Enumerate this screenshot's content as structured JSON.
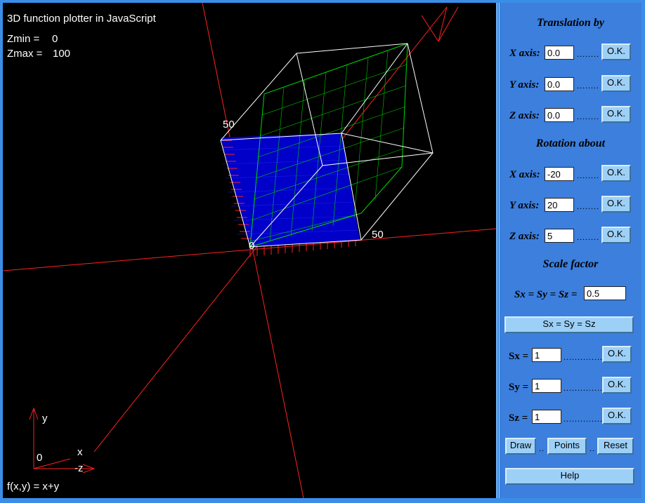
{
  "plot": {
    "title": "3D function plotter in JavaScript",
    "zmin_label": "Zmin =",
    "zmin_value": "0",
    "zmax_label": "Zmax =",
    "zmax_value": "100",
    "tick_50_left": "50",
    "tick_50_right": "50",
    "tick_0": "0",
    "function_label": "f(x,y) = x+y",
    "axes_icon": {
      "y": "y",
      "x": "x",
      "z": "-z",
      "origin": "0"
    },
    "colors": {
      "surface_front": "#00d000",
      "surface_back": "#0000c8",
      "axis": "#ff2020",
      "box": "#ffffff"
    }
  },
  "panel": {
    "translation": {
      "heading": "Translation by",
      "x_label": "X axis:",
      "x_value": "0.0",
      "y_label": "Y axis:",
      "y_value": "0.0",
      "z_label": "Z axis:",
      "z_value": "0.0",
      "ok": "O.K."
    },
    "rotation": {
      "heading": "Rotation about",
      "x_label": "X axis:",
      "x_value": "-20",
      "y_label": "Y axis:",
      "y_value": "20",
      "z_label": "Z axis:",
      "z_value": "5",
      "ok": "O.K."
    },
    "scale": {
      "heading": "Scale factor",
      "uniform_label": "Sx = Sy = Sz =",
      "uniform_value": "0.5",
      "uniform_button": "Sx = Sy = Sz",
      "sx_label": "Sx =",
      "sx_value": "1",
      "sy_label": "Sy =",
      "sy_value": "1",
      "sz_label": "Sz =",
      "sz_value": "1",
      "ok": "O.K."
    },
    "dots_short": "........",
    "dots_long": "..............",
    "dots_tiny": "..",
    "draw_button": "Draw",
    "points_button": "Points",
    "reset_button": "Reset",
    "help_button": "Help"
  }
}
